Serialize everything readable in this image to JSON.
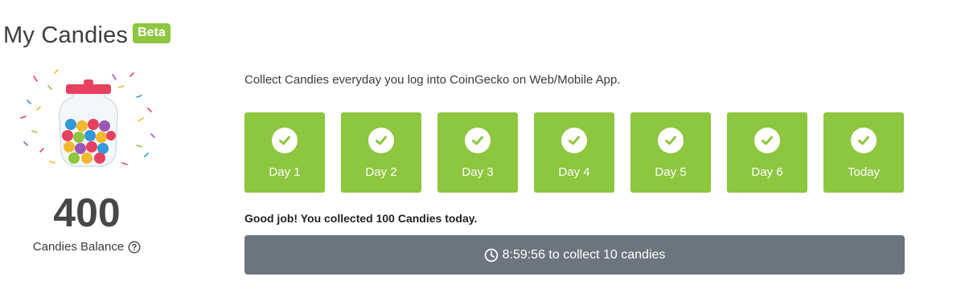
{
  "header": {
    "title": "My Candies",
    "badge": "Beta"
  },
  "balance": {
    "value": "400",
    "label": "Candies Balance",
    "help_icon": "question-circle-icon"
  },
  "intro": {
    "text": "Collect Candies everyday you log into CoinGecko on Web/Mobile App."
  },
  "days": [
    {
      "label": "Day 1",
      "collected": true
    },
    {
      "label": "Day 2",
      "collected": true
    },
    {
      "label": "Day 3",
      "collected": true
    },
    {
      "label": "Day 4",
      "collected": true
    },
    {
      "label": "Day 5",
      "collected": true
    },
    {
      "label": "Day 6",
      "collected": true
    },
    {
      "label": "Today",
      "collected": true
    }
  ],
  "status": {
    "text": "Good job! You collected 100 Candies today."
  },
  "collect": {
    "label": "8:59:56 to collect 10 candies",
    "icon": "clock-icon"
  },
  "colors": {
    "accent": "#8dc63f",
    "button": "#6c757d",
    "jar_lid": "#e8415f"
  }
}
